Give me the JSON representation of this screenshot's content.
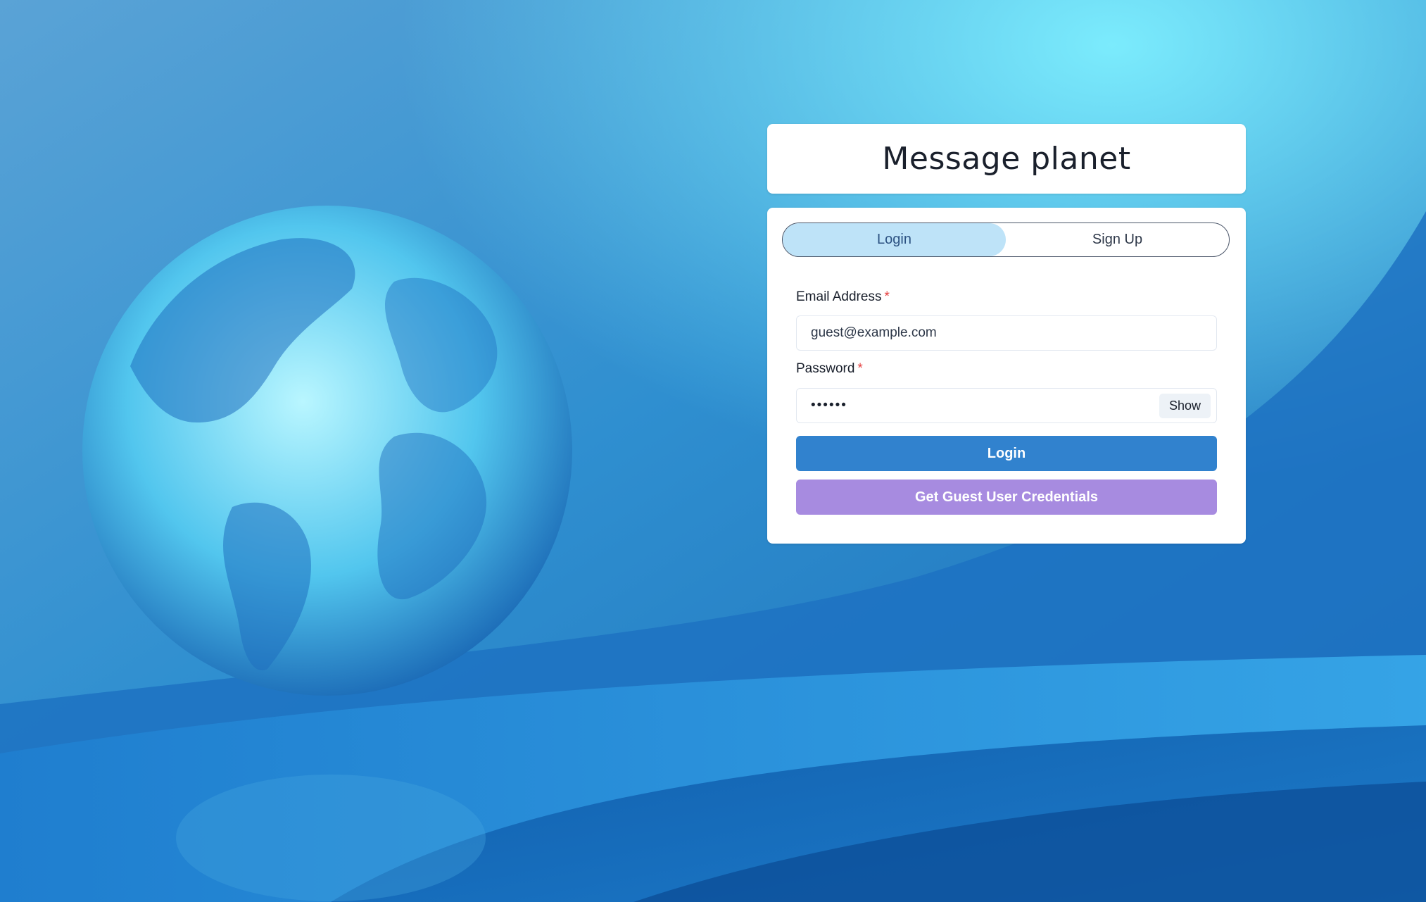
{
  "app": {
    "title": "Message planet"
  },
  "tabs": [
    {
      "label": "Login",
      "active": true
    },
    {
      "label": "Sign Up",
      "active": false
    }
  ],
  "form": {
    "email_label": "Email Address",
    "email_value": "guest@example.com",
    "password_label": "Password",
    "password_value": "••••••",
    "required_marker": "*",
    "show_label": "Show",
    "login_button": "Login",
    "guest_button": "Get Guest User Credentials"
  },
  "colors": {
    "accent": "#3182ce",
    "secondary": "#a78be0",
    "active_tab": "#bee3f8",
    "required": "#e53e3e"
  },
  "icons": {
    "background": "globe-illustration"
  }
}
